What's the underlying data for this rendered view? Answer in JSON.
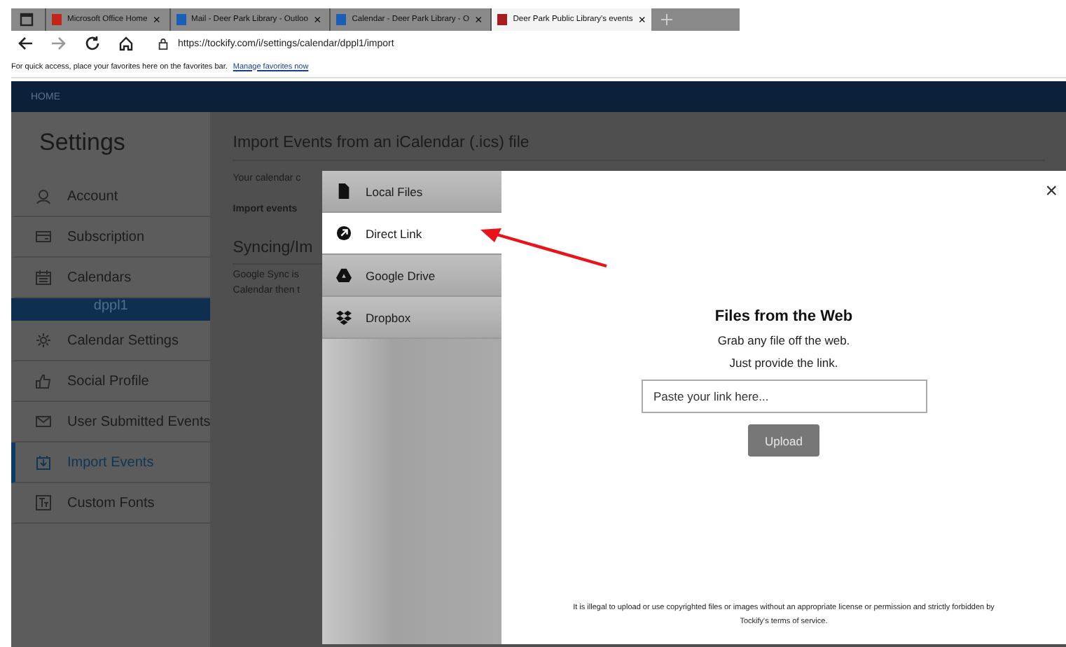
{
  "browser": {
    "tabs": [
      {
        "title": "Microsoft Office Home",
        "close": "×",
        "selected": false
      },
      {
        "title": "Mail - Deer Park Library - Outloo",
        "close": "×",
        "selected": false
      },
      {
        "title": "Calendar - Deer Park Library - O",
        "close": "×",
        "selected": false
      },
      {
        "title": "Deer Park Public Library's events",
        "close": "×",
        "selected": true
      }
    ],
    "url": "https://tockify.com/i/settings/calendar/dppl1/import",
    "favorites_hint": "For quick access, place your favorites here on the favorites bar.",
    "favorites_link": "Manage favorites now"
  },
  "nav": {
    "home": "HOME"
  },
  "sidebar": {
    "title": "Settings",
    "items": [
      {
        "label": "Account",
        "kind": "item",
        "selected": false
      },
      {
        "label": "Subscription",
        "kind": "item",
        "selected": false
      },
      {
        "label": "Calendars",
        "kind": "item",
        "selected": false
      },
      {
        "label": "dppl1",
        "kind": "calendar",
        "selected": true
      },
      {
        "label": "Calendar Settings",
        "kind": "item",
        "selected": false
      },
      {
        "label": "Social Profile",
        "kind": "item",
        "selected": false
      },
      {
        "label": "User Submitted Events",
        "kind": "item",
        "selected": false
      },
      {
        "label": "Import Events",
        "kind": "item",
        "selected": true
      },
      {
        "label": "Custom Fonts",
        "kind": "item",
        "selected": false
      }
    ]
  },
  "main": {
    "title": "Import Events from an iCalendar (.ics) file",
    "intro": "Your calendar c",
    "import_label": "Import events",
    "sync_title": "Syncing/Im",
    "sync_lines": [
      "Google Sync is",
      "Calendar then t"
    ]
  },
  "modal": {
    "sources": [
      {
        "label": "Local Files",
        "selected": false
      },
      {
        "label": "Direct Link",
        "selected": true
      },
      {
        "label": "Google Drive",
        "selected": false
      },
      {
        "label": "Dropbox",
        "selected": false
      }
    ],
    "close": "×",
    "heading": "Files from the Web",
    "lines": [
      "Grab any file off the web.",
      "Just provide the link."
    ],
    "placeholder": "Paste your link here...",
    "upload": "Upload",
    "disclaimer": "It is illegal to upload or use copyrighted files or images without an appropriate license or permission and strictly forbidden by Tockify's terms of service."
  }
}
